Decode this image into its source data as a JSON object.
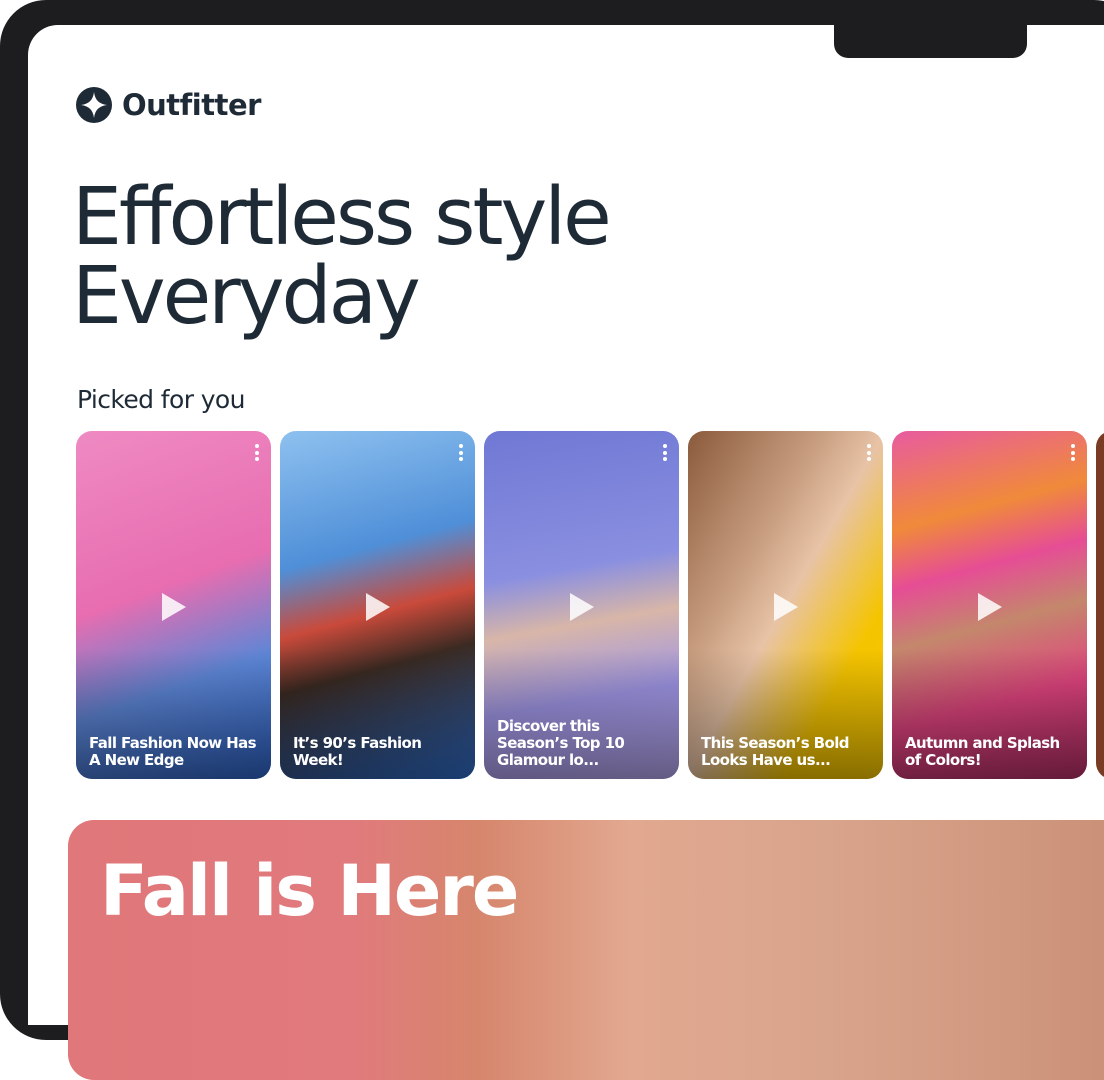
{
  "brand": {
    "name": "Outfitter",
    "icon": "outfitter-logo-icon"
  },
  "hero": {
    "line1": "Effortless style",
    "line2": "Everyday"
  },
  "picked": {
    "title": "Picked for you",
    "cards": [
      {
        "caption": "Fall Fashion Now Has A New Edge",
        "bg": "#e977b6"
      },
      {
        "caption": "It’s 90’s Fashion Week!",
        "bg": "#4f8fd8"
      },
      {
        "caption": "Discover this Season’s Top 10 Glamour lo...",
        "bg": "#7d84d8"
      },
      {
        "caption": "This Season’s Bold Looks Have us...",
        "bg": "#f5c400"
      },
      {
        "caption": "Autumn and Splash of Colors!",
        "bg": "#e64d95"
      }
    ]
  },
  "banner": {
    "title": "Fall is Here"
  }
}
